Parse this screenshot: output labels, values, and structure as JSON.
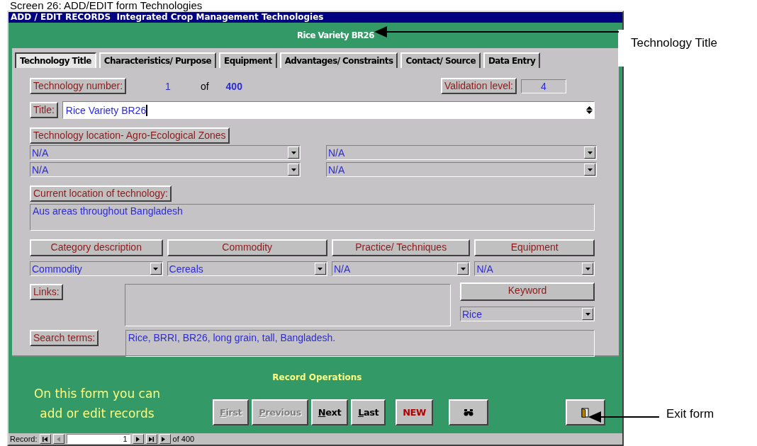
{
  "caption": "Screen 26: ADD/EDIT form Technologies",
  "window": {
    "title": "ADD / EDIT RECORDS  Integrated Crop Management Technologies"
  },
  "header": {
    "technology_title": "Rice Variety BR26"
  },
  "tabs": [
    {
      "label": "Technology Title",
      "selected": true
    },
    {
      "label": "Characteristics/ Purpose",
      "selected": false
    },
    {
      "label": "Equipment",
      "selected": false
    },
    {
      "label": "Advantages/ Constraints",
      "selected": false
    },
    {
      "label": "Contact/ Source",
      "selected": false
    },
    {
      "label": "Data Entry",
      "selected": false
    }
  ],
  "technology_number": {
    "label": "Technology number:",
    "value": "1",
    "of": "of",
    "total": "400"
  },
  "validation": {
    "label": "Validation level:",
    "value": "4"
  },
  "title_field": {
    "label": "Title:",
    "value": "Rice Variety BR26"
  },
  "zones": {
    "label": "Technology location- Agro-Ecological Zones",
    "values": [
      "N/A",
      "N/A",
      "N/A",
      "N/A"
    ]
  },
  "current_location": {
    "label": "Current location of technology:",
    "value": "Aus areas throughout Bangladesh"
  },
  "categories": [
    {
      "label": "Category description",
      "value": "Commodity"
    },
    {
      "label": "Commodity",
      "value": "Cereals"
    },
    {
      "label": "Practice/ Techniques",
      "value": "N/A"
    },
    {
      "label": "Equipment",
      "value": "N/A"
    }
  ],
  "links": {
    "label": "Links:"
  },
  "keyword": {
    "label": "Keyword",
    "value": "Rice"
  },
  "search_terms": {
    "label": "Search terms:",
    "value": "Rice, BRRI, BR26, long grain, tall, Bangladesh."
  },
  "footer": {
    "note": [
      "On this form you can",
      "add or edit records"
    ],
    "operations_label": "Record Operations",
    "buttons": [
      {
        "label": "First",
        "kind": "nav",
        "disabled": true
      },
      {
        "label": "Previous",
        "kind": "nav",
        "disabled": true
      },
      {
        "label": "Next",
        "kind": "nav",
        "disabled": false
      },
      {
        "label": "Last",
        "kind": "nav",
        "disabled": false
      },
      {
        "label": "NEW",
        "kind": "new",
        "disabled": false
      }
    ]
  },
  "record_nav": {
    "label": "Record:",
    "current": "1",
    "of": "of 400"
  },
  "annotations": [
    {
      "text": "Technology Title",
      "kind": "header"
    },
    {
      "text": "Exit form",
      "kind": "exit"
    }
  ]
}
